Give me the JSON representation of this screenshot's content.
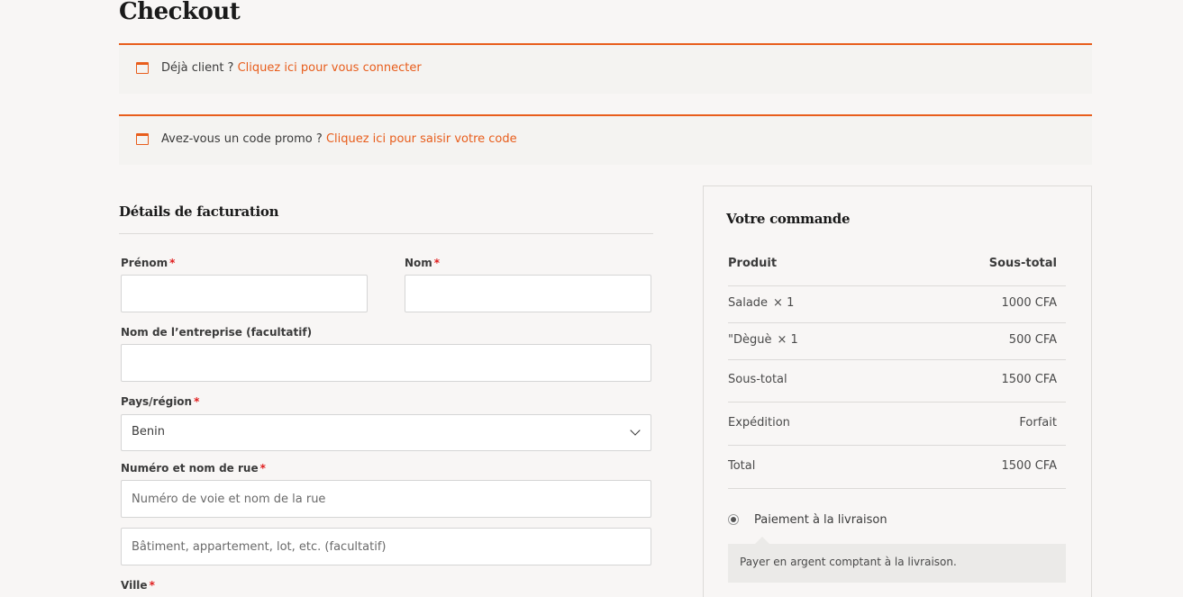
{
  "page": {
    "title": "Checkout"
  },
  "notices": {
    "login": {
      "text": "Déjà client ?",
      "link": "Cliquez ici pour vous connecter"
    },
    "promo": {
      "text": "Avez-vous un code promo ?",
      "link": "Cliquez ici pour saisir votre code"
    }
  },
  "billing": {
    "title": "Détails de facturation",
    "first_name": {
      "label": "Prénom",
      "required": "*",
      "value": ""
    },
    "last_name": {
      "label": "Nom",
      "required": "*",
      "value": ""
    },
    "company": {
      "label": "Nom de l’entreprise (facultatif)",
      "value": ""
    },
    "country": {
      "label": "Pays/région",
      "required": "*",
      "value": "Benin"
    },
    "street": {
      "label": "Numéro et nom de rue",
      "required": "*",
      "placeholder": "Numéro de voie et nom de la rue",
      "placeholder2": "Bâtiment, appartement, lot, etc. (facultatif)"
    },
    "city": {
      "label": "Ville",
      "required": "*"
    }
  },
  "order": {
    "title": "Votre commande",
    "header": {
      "product": "Produit",
      "subtotal": "Sous-total"
    },
    "items": [
      {
        "name": "Salade",
        "qty": "× 1",
        "price": "1000 CFA"
      },
      {
        "name": "\"Dèguè",
        "qty": "× 1",
        "price": "500 CFA"
      }
    ],
    "subtotal": {
      "label": "Sous-total",
      "value": "1500 CFA"
    },
    "shipping": {
      "label": "Expédition",
      "value": "Forfait"
    },
    "total": {
      "label": "Total",
      "value": "1500 CFA"
    },
    "payment": {
      "label": "Paiement à la livraison",
      "description": "Payer en argent comptant à la livraison."
    }
  },
  "colors": {
    "accent": "#e85d1c",
    "required": "#e01e1e",
    "background": "#f8f6f5"
  }
}
